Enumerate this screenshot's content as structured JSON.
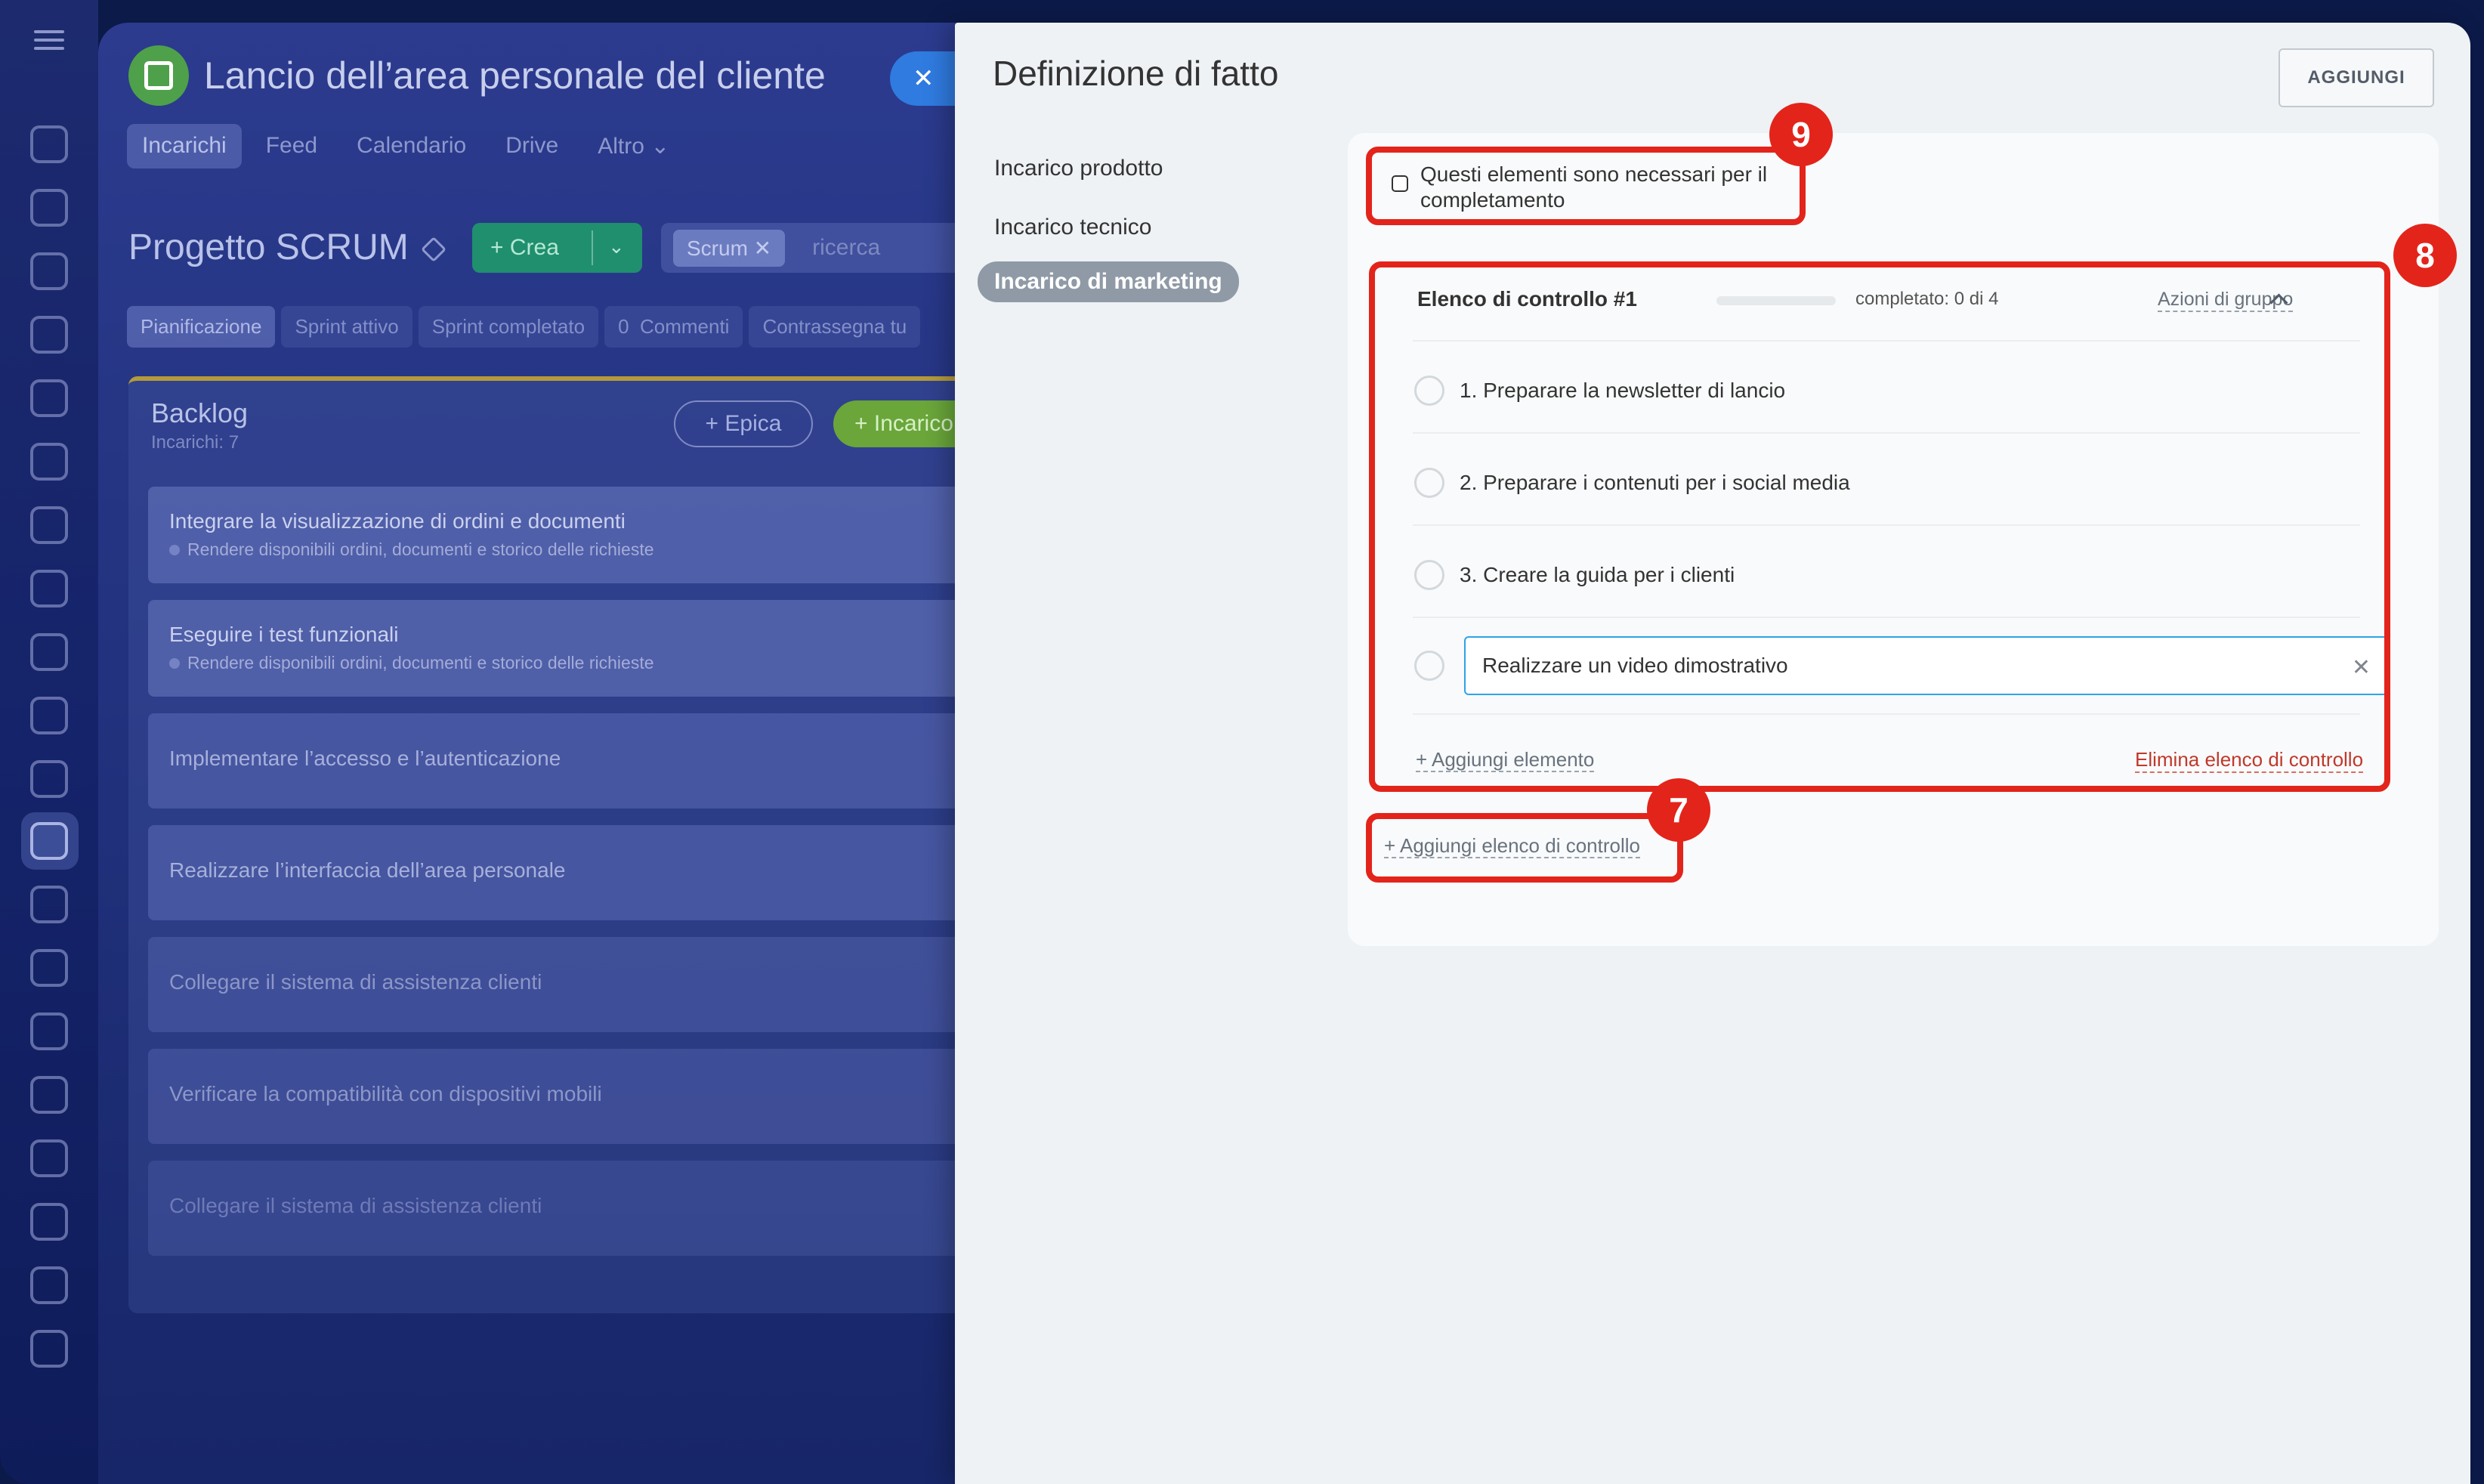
{
  "background": {
    "workspace_title": "Lancio dell’area personale del cliente",
    "tabs": [
      "Incarichi",
      "Feed",
      "Calendario",
      "Drive",
      "Altro"
    ],
    "project_title": "Progetto SCRUM",
    "crea_label": "Crea",
    "filter_chip": "Scrum",
    "search_placeholder": "ricerca",
    "subtabs": [
      "Pianificazione",
      "Sprint attivo",
      "Sprint completato"
    ],
    "comments_count": "0",
    "comments_label": "Commenti",
    "mark_label": "Contrassegna tu",
    "backlog": {
      "title": "Backlog",
      "subtitle": "Incarichi: 7",
      "epic_button": "Epica",
      "task_button": "Incarico",
      "items": [
        {
          "title": "Integrare la visualizzazione di ordini e documenti",
          "subtitle": "Rendere disponibili ordini, documenti e storico delle richieste"
        },
        {
          "title": "Eseguire i test funzionali",
          "subtitle": "Rendere disponibili ordini, documenti e storico delle richieste"
        },
        {
          "title": "Implementare l’accesso e l’autenticazione",
          "subtitle": ""
        },
        {
          "title": "Realizzare l’interfaccia dell’area personale",
          "subtitle": ""
        },
        {
          "title": "Collegare il sistema di assistenza clienti",
          "subtitle": ""
        },
        {
          "title": "Verificare la compatibilità con dispositivi mobili",
          "subtitle": ""
        },
        {
          "title": "Collegare il sistema di assistenza clienti",
          "subtitle": ""
        }
      ]
    }
  },
  "panel": {
    "title": "Definizione di fatto",
    "add_button": "AGGIUNGI",
    "nav": [
      "Incarico prodotto",
      "Incarico tecnico",
      "Incarico di marketing"
    ],
    "required_checkbox_label": "Questi elementi sono necessari per il completamento",
    "checklist": {
      "title": "Elenco di controllo #1",
      "progress_text": "completato: 0 di 4",
      "progress_fraction": 0,
      "group_actions": "Azioni di gruppo",
      "items": [
        "1. Preparare la newsletter di lancio",
        "2. Preparare i contenuti per i social media",
        "3. Creare la guida per i clienti"
      ],
      "editing_value": "Realizzare un video dimostrativo",
      "add_item": "+ Aggiungi elemento",
      "delete_list": "Elimina elenco di controllo"
    },
    "add_checklist": "+ Aggiungi elenco di controllo"
  },
  "annotations": {
    "badge_required": "9",
    "badge_checklist": "8",
    "badge_add_checklist": "7",
    "highlight_color": "#e3241b"
  },
  "colors": {
    "accent_blue": "#2fa4e7",
    "danger": "#c0392b"
  }
}
